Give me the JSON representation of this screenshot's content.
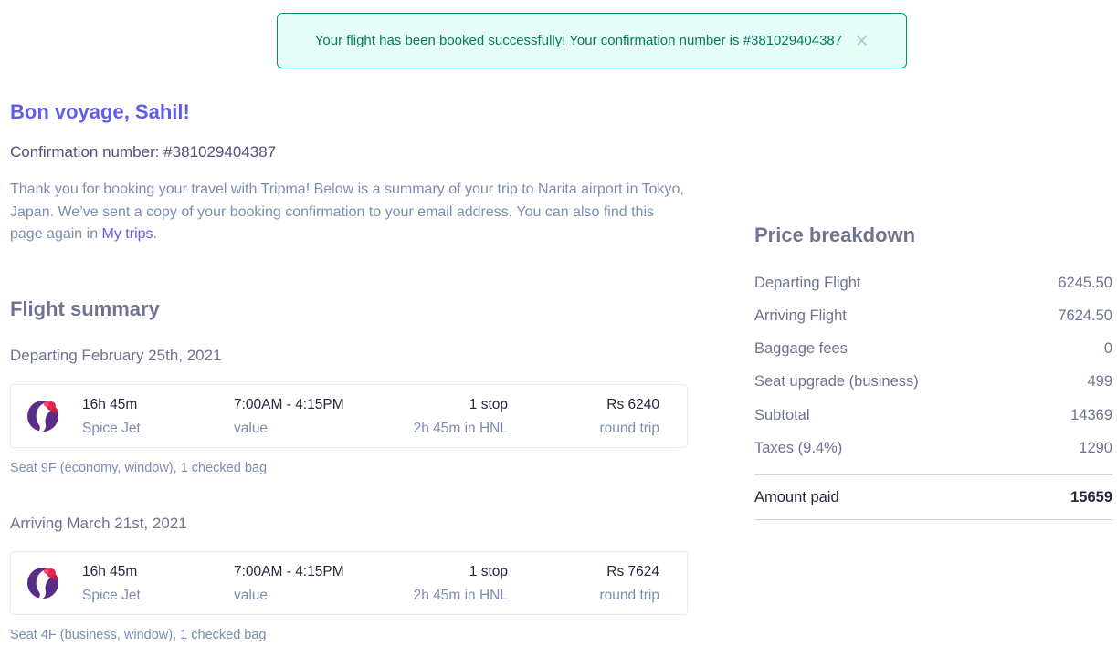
{
  "toast": {
    "message": "Your flight has been booked successfully! Your confirmation number is #381029404387",
    "close_glyph": "✕"
  },
  "greeting": "Bon voyage, Sahil!",
  "confirmation_line": "Confirmation number: #381029404387",
  "thanks": {
    "text_before": "Thank you for booking your travel with Tripma! Below is a summary of your trip to Narita airport in Tokyo, Japan. We’ve sent a copy of your booking confirmation to your email address. You can also find this page again in ",
    "link": "My trips",
    "text_after": "."
  },
  "flight_summary": {
    "title": "Flight summary",
    "legs": [
      {
        "heading": "Departing February 25th, 2021",
        "duration": "16h 45m",
        "airline": "Spice Jet",
        "time": "7:00AM - 4:15PM",
        "time_sub": "value",
        "stops": "1 stop",
        "layover": "2h 45m in HNL",
        "price": "Rs 6240",
        "trip_type": "round trip",
        "seat_note": "Seat 9F (economy, window), 1 checked bag"
      },
      {
        "heading": "Arriving March 21st, 2021",
        "duration": "16h 45m",
        "airline": "Spice Jet",
        "time": "7:00AM - 4:15PM",
        "time_sub": "value",
        "stops": "1 stop",
        "layover": "2h 45m in HNL",
        "price": "Rs 7624",
        "trip_type": "round trip",
        "seat_note": "Seat 4F (business, window), 1 checked bag"
      }
    ]
  },
  "price_breakdown": {
    "title": "Price breakdown",
    "rows": [
      {
        "label": "Departing Flight",
        "value": "6245.50"
      },
      {
        "label": "Arriving Flight",
        "value": "7624.50"
      },
      {
        "label": "Baggage fees",
        "value": "0"
      },
      {
        "label": "Seat upgrade (business)",
        "value": "499"
      },
      {
        "label": "Subtotal",
        "value": "14369"
      },
      {
        "label": "Taxes (9.4%)",
        "value": "1290"
      }
    ],
    "total": {
      "label": "Amount paid",
      "value": "15659"
    }
  },
  "colors": {
    "accent": "#605dec",
    "toast_bg": "#e6fcf6",
    "toast_border": "#0a8a6a",
    "muted_text": "#7c8db0"
  }
}
